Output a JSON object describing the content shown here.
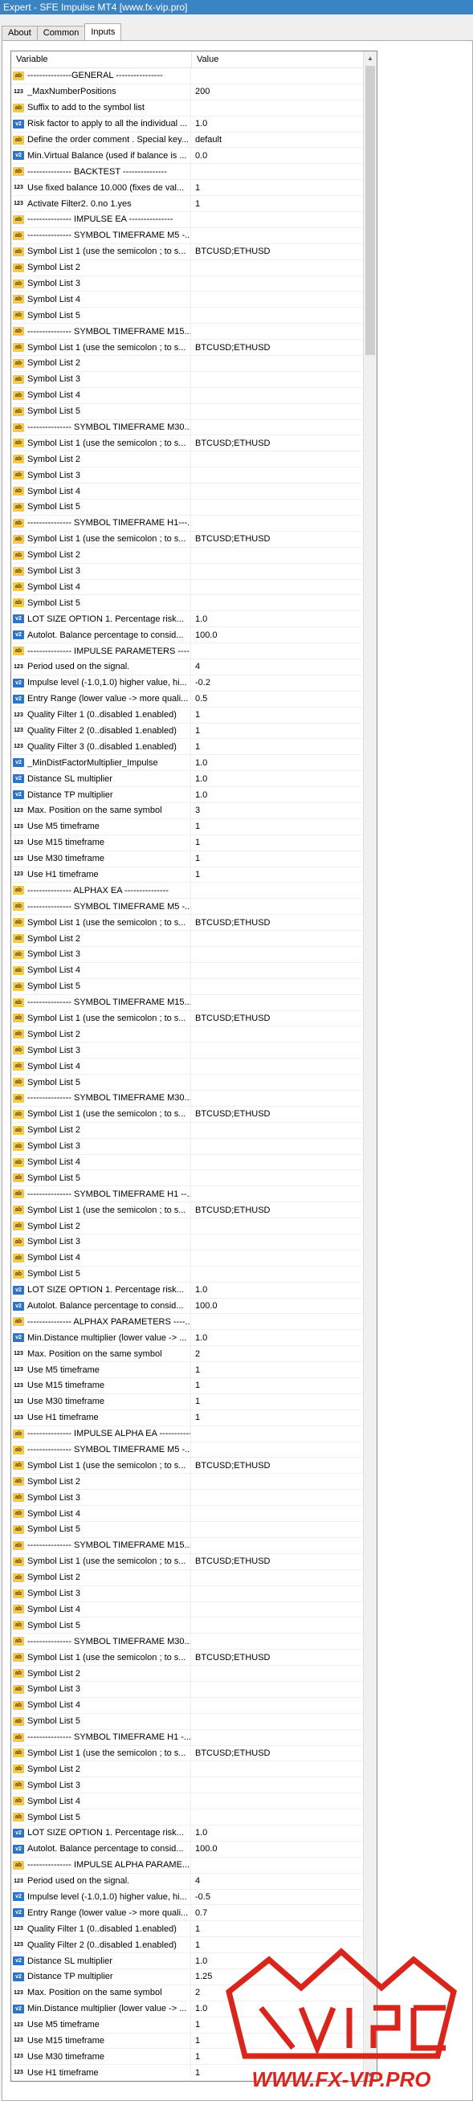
{
  "window": {
    "title": "Expert - SFE Impulse MT4 [www.fx-vip.pro]",
    "minimize": "–",
    "maximize": "☐",
    "close": "✕"
  },
  "tabs": [
    {
      "label": "About"
    },
    {
      "label": "Common"
    },
    {
      "label": "Inputs"
    }
  ],
  "grid": {
    "header": {
      "variable": "Variable",
      "value": "Value"
    },
    "rows": [
      {
        "icon": "ab",
        "name": "---------------GENERAL ----------------",
        "value": ""
      },
      {
        "icon": "123",
        "name": "_MaxNumberPositions",
        "value": "200"
      },
      {
        "icon": "ab",
        "name": "Suffix to add to the symbol list",
        "value": ""
      },
      {
        "icon": "v2",
        "name": "Risk factor to apply to all the individual ...",
        "value": "1.0"
      },
      {
        "icon": "ab",
        "name": "Define the order comment . Special key...",
        "value": "default"
      },
      {
        "icon": "v2",
        "name": "Min.Virtual Balance (used if balance is ...",
        "value": "0.0"
      },
      {
        "icon": "ab",
        "name": "--------------- BACKTEST ---------------",
        "value": ""
      },
      {
        "icon": "123",
        "name": "Use fixed balance 10.000 (fixes de val...",
        "value": "1"
      },
      {
        "icon": "123",
        "name": "Activate Filter2.  0.no  1.yes",
        "value": "1"
      },
      {
        "icon": "ab",
        "name": "--------------- IMPULSE EA ---------------",
        "value": ""
      },
      {
        "icon": "ab",
        "name": "--------------- SYMBOL TIMEFRAME M5 -...",
        "value": ""
      },
      {
        "icon": "ab",
        "name": "Symbol List 1 (use the semicolon ; to s...",
        "value": "BTCUSD;ETHUSD"
      },
      {
        "icon": "ab",
        "name": "Symbol List 2",
        "value": ""
      },
      {
        "icon": "ab",
        "name": "Symbol List 3",
        "value": ""
      },
      {
        "icon": "ab",
        "name": "Symbol List 4",
        "value": ""
      },
      {
        "icon": "ab",
        "name": "Symbol List 5",
        "value": ""
      },
      {
        "icon": "ab",
        "name": "--------------- SYMBOL TIMEFRAME M15...",
        "value": ""
      },
      {
        "icon": "ab",
        "name": "Symbol List 1 (use the semicolon ; to s...",
        "value": "BTCUSD;ETHUSD"
      },
      {
        "icon": "ab",
        "name": "Symbol List 2",
        "value": ""
      },
      {
        "icon": "ab",
        "name": "Symbol List 3",
        "value": ""
      },
      {
        "icon": "ab",
        "name": "Symbol List 4",
        "value": ""
      },
      {
        "icon": "ab",
        "name": "Symbol List 5",
        "value": ""
      },
      {
        "icon": "ab",
        "name": "--------------- SYMBOL TIMEFRAME M30...",
        "value": ""
      },
      {
        "icon": "ab",
        "name": "Symbol List 1 (use the semicolon ; to s...",
        "value": "BTCUSD;ETHUSD"
      },
      {
        "icon": "ab",
        "name": "Symbol List 2",
        "value": ""
      },
      {
        "icon": "ab",
        "name": "Symbol List 3",
        "value": ""
      },
      {
        "icon": "ab",
        "name": "Symbol List 4",
        "value": ""
      },
      {
        "icon": "ab",
        "name": "Symbol List 5",
        "value": ""
      },
      {
        "icon": "ab",
        "name": "--------------- SYMBOL TIMEFRAME H1---...",
        "value": ""
      },
      {
        "icon": "ab",
        "name": "Symbol List 1 (use the semicolon ; to s...",
        "value": "BTCUSD;ETHUSD"
      },
      {
        "icon": "ab",
        "name": "Symbol List 2",
        "value": ""
      },
      {
        "icon": "ab",
        "name": "Symbol List 3",
        "value": ""
      },
      {
        "icon": "ab",
        "name": "Symbol List 4",
        "value": ""
      },
      {
        "icon": "ab",
        "name": "Symbol List 5",
        "value": ""
      },
      {
        "icon": "v2",
        "name": "LOT SIZE OPTION 1. Percentage risk...",
        "value": "1.0"
      },
      {
        "icon": "v2",
        "name": "Autolot. Balance percentage to consid...",
        "value": "100.0"
      },
      {
        "icon": "ab",
        "name": "--------------- IMPULSE PARAMETERS ----...",
        "value": ""
      },
      {
        "icon": "123",
        "name": "Period used on the signal.",
        "value": "4"
      },
      {
        "icon": "v2",
        "name": "Impulse level (-1.0,1.0) higher value, hi...",
        "value": "-0.2"
      },
      {
        "icon": "v2",
        "name": "Entry Range (lower value -> more quali...",
        "value": "0.5"
      },
      {
        "icon": "123",
        "name": "Quality Filter 1 (0..disabled 1.enabled)",
        "value": "1"
      },
      {
        "icon": "123",
        "name": "Quality Filter 2 (0..disabled 1.enabled)",
        "value": "1"
      },
      {
        "icon": "123",
        "name": "Quality Filter 3 (0..disabled 1.enabled)",
        "value": "1"
      },
      {
        "icon": "v2",
        "name": "_MinDistFactorMultiplier_Impulse",
        "value": "1.0"
      },
      {
        "icon": "v2",
        "name": "Distance SL multiplier",
        "value": "1.0"
      },
      {
        "icon": "v2",
        "name": "Distance TP multiplier",
        "value": "1.0"
      },
      {
        "icon": "123",
        "name": "Max. Position on the same symbol",
        "value": "3"
      },
      {
        "icon": "123",
        "name": "Use M5 timeframe",
        "value": "1"
      },
      {
        "icon": "123",
        "name": "Use M15 timeframe",
        "value": "1"
      },
      {
        "icon": "123",
        "name": "Use M30 timeframe",
        "value": "1"
      },
      {
        "icon": "123",
        "name": "Use H1 timeframe",
        "value": "1"
      },
      {
        "icon": "ab",
        "name": "--------------- ALPHAX EA ---------------",
        "value": ""
      },
      {
        "icon": "ab",
        "name": "--------------- SYMBOL TIMEFRAME M5 -...",
        "value": ""
      },
      {
        "icon": "ab",
        "name": "Symbol List 1 (use the semicolon ; to s...",
        "value": "BTCUSD;ETHUSD"
      },
      {
        "icon": "ab",
        "name": "Symbol List 2",
        "value": ""
      },
      {
        "icon": "ab",
        "name": "Symbol List 3",
        "value": ""
      },
      {
        "icon": "ab",
        "name": "Symbol List 4",
        "value": ""
      },
      {
        "icon": "ab",
        "name": "Symbol List 5",
        "value": ""
      },
      {
        "icon": "ab",
        "name": "--------------- SYMBOL TIMEFRAME M15...",
        "value": ""
      },
      {
        "icon": "ab",
        "name": "Symbol List 1 (use the semicolon ; to s...",
        "value": "BTCUSD;ETHUSD"
      },
      {
        "icon": "ab",
        "name": "Symbol List 2",
        "value": ""
      },
      {
        "icon": "ab",
        "name": "Symbol List 3",
        "value": ""
      },
      {
        "icon": "ab",
        "name": "Symbol List 4",
        "value": ""
      },
      {
        "icon": "ab",
        "name": "Symbol List 5",
        "value": ""
      },
      {
        "icon": "ab",
        "name": "--------------- SYMBOL TIMEFRAME M30...",
        "value": ""
      },
      {
        "icon": "ab",
        "name": "Symbol List 1 (use the semicolon ; to s...",
        "value": "BTCUSD;ETHUSD"
      },
      {
        "icon": "ab",
        "name": "Symbol List 2",
        "value": ""
      },
      {
        "icon": "ab",
        "name": "Symbol List 3",
        "value": ""
      },
      {
        "icon": "ab",
        "name": "Symbol List 4",
        "value": ""
      },
      {
        "icon": "ab",
        "name": "Symbol List 5",
        "value": ""
      },
      {
        "icon": "ab",
        "name": "--------------- SYMBOL TIMEFRAME H1 --...",
        "value": ""
      },
      {
        "icon": "ab",
        "name": "Symbol List 1 (use the semicolon ; to s...",
        "value": "BTCUSD;ETHUSD"
      },
      {
        "icon": "ab",
        "name": "Symbol List 2",
        "value": ""
      },
      {
        "icon": "ab",
        "name": "Symbol List 3",
        "value": ""
      },
      {
        "icon": "ab",
        "name": "Symbol List 4",
        "value": ""
      },
      {
        "icon": "ab",
        "name": "Symbol List 5",
        "value": ""
      },
      {
        "icon": "v2",
        "name": "LOT SIZE OPTION 1. Percentage risk...",
        "value": "1.0"
      },
      {
        "icon": "v2",
        "name": "Autolot. Balance percentage to consid...",
        "value": "100.0"
      },
      {
        "icon": "ab",
        "name": "--------------- ALPHAX PARAMETERS ----...",
        "value": ""
      },
      {
        "icon": "v2",
        "name": "Min.Distance multiplier (lower value -> ...",
        "value": "1.0"
      },
      {
        "icon": "123",
        "name": "Max. Position on the same symbol",
        "value": "2"
      },
      {
        "icon": "123",
        "name": "Use M5 timeframe",
        "value": "1"
      },
      {
        "icon": "123",
        "name": "Use M15 timeframe",
        "value": "1"
      },
      {
        "icon": "123",
        "name": "Use M30 timeframe",
        "value": "1"
      },
      {
        "icon": "123",
        "name": "Use H1 timeframe",
        "value": "1"
      },
      {
        "icon": "ab",
        "name": "--------------- IMPULSE ALPHA EA ---------------",
        "value": ""
      },
      {
        "icon": "ab",
        "name": "--------------- SYMBOL TIMEFRAME M5 -...",
        "value": ""
      },
      {
        "icon": "ab",
        "name": "Symbol List 1 (use the semicolon ; to s...",
        "value": "BTCUSD;ETHUSD"
      },
      {
        "icon": "ab",
        "name": "Symbol List 2",
        "value": ""
      },
      {
        "icon": "ab",
        "name": "Symbol List 3",
        "value": ""
      },
      {
        "icon": "ab",
        "name": "Symbol List 4",
        "value": ""
      },
      {
        "icon": "ab",
        "name": "Symbol List 5",
        "value": ""
      },
      {
        "icon": "ab",
        "name": "--------------- SYMBOL TIMEFRAME M15...",
        "value": ""
      },
      {
        "icon": "ab",
        "name": "Symbol List 1 (use the semicolon ; to s...",
        "value": "BTCUSD;ETHUSD"
      },
      {
        "icon": "ab",
        "name": "Symbol List 2",
        "value": ""
      },
      {
        "icon": "ab",
        "name": "Symbol List 3",
        "value": ""
      },
      {
        "icon": "ab",
        "name": "Symbol List 4",
        "value": ""
      },
      {
        "icon": "ab",
        "name": "Symbol List 5",
        "value": ""
      },
      {
        "icon": "ab",
        "name": "--------------- SYMBOL TIMEFRAME M30...",
        "value": ""
      },
      {
        "icon": "ab",
        "name": "Symbol List 1 (use the semicolon ; to s...",
        "value": "BTCUSD;ETHUSD"
      },
      {
        "icon": "ab",
        "name": "Symbol List 2",
        "value": ""
      },
      {
        "icon": "ab",
        "name": "Symbol List 3",
        "value": ""
      },
      {
        "icon": "ab",
        "name": "Symbol List 4",
        "value": ""
      },
      {
        "icon": "ab",
        "name": "Symbol List 5",
        "value": ""
      },
      {
        "icon": "ab",
        "name": "--------------- SYMBOL TIMEFRAME H1 -...",
        "value": ""
      },
      {
        "icon": "ab",
        "name": "Symbol List 1 (use the semicolon ; to s...",
        "value": "BTCUSD;ETHUSD"
      },
      {
        "icon": "ab",
        "name": "Symbol List 2",
        "value": ""
      },
      {
        "icon": "ab",
        "name": "Symbol List 3",
        "value": ""
      },
      {
        "icon": "ab",
        "name": "Symbol List 4",
        "value": ""
      },
      {
        "icon": "ab",
        "name": "Symbol List 5",
        "value": ""
      },
      {
        "icon": "v2",
        "name": "LOT SIZE OPTION 1. Percentage risk...",
        "value": "1.0"
      },
      {
        "icon": "v2",
        "name": "Autolot. Balance percentage to consid...",
        "value": "100.0"
      },
      {
        "icon": "ab",
        "name": "--------------- IMPULSE ALPHA PARAME...",
        "value": ""
      },
      {
        "icon": "123",
        "name": "Period used on the signal.",
        "value": "4"
      },
      {
        "icon": "v2",
        "name": "Impulse level (-1.0,1.0) higher value, hi...",
        "value": "-0.5"
      },
      {
        "icon": "v2",
        "name": "Entry Range (lower value -> more quali...",
        "value": "0.7"
      },
      {
        "icon": "123",
        "name": "Quality Filter 1 (0..disabled 1.enabled)",
        "value": "1"
      },
      {
        "icon": "123",
        "name": "Quality Filter 2 (0..disabled 1.enabled)",
        "value": "1"
      },
      {
        "icon": "v2",
        "name": "Distance SL multiplier",
        "value": "1.0"
      },
      {
        "icon": "v2",
        "name": "Distance TP multiplier",
        "value": "1.25"
      },
      {
        "icon": "123",
        "name": "Max. Position on the same symbol",
        "value": "2"
      },
      {
        "icon": "v2",
        "name": "Min.Distance multiplier (lower value -> ...",
        "value": "1.0"
      },
      {
        "icon": "123",
        "name": "Use M5 timeframe",
        "value": "1"
      },
      {
        "icon": "123",
        "name": "Use M15 timeframe",
        "value": "1"
      },
      {
        "icon": "123",
        "name": "Use M30 timeframe",
        "value": "1"
      },
      {
        "icon": "123",
        "name": "Use H1 timeframe",
        "value": "1"
      }
    ]
  },
  "icon_labels": {
    "ab": "ab",
    "123": "123",
    "v2": "v2"
  },
  "watermark": {
    "text": "WWW.FX-VIP.PRO",
    "color": "#d9261c"
  }
}
